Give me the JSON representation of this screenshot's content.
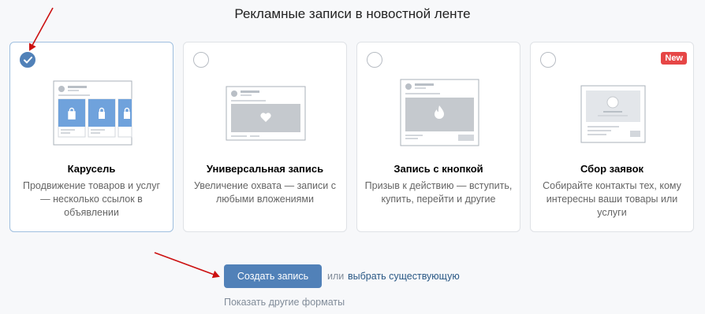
{
  "page": {
    "title": "Рекламные записи в новостной ленте"
  },
  "cards": [
    {
      "title": "Карусель",
      "description": "Продвижение товаров и услуг — несколько ссылок в объявлении",
      "selected": true,
      "illustration": "carousel-post-icon"
    },
    {
      "title": "Универсальная запись",
      "description": "Увеличение охвата — записи с любыми вложениями",
      "selected": false,
      "illustration": "universal-post-icon"
    },
    {
      "title": "Запись с кнопкой",
      "description": "Призыв к действию — вступить, купить, перейти и другие",
      "selected": false,
      "illustration": "button-post-icon"
    },
    {
      "title": "Сбор заявок",
      "description": "Собирайте контакты тех, кому интересны ваши товары или услуги",
      "selected": false,
      "badge": "New",
      "illustration": "lead-form-icon"
    }
  ],
  "actions": {
    "create_label": "Создать запись",
    "or_label": "или",
    "choose_existing_label": "выбрать существующую",
    "show_other_label": "Показать другие форматы"
  },
  "colors": {
    "accent": "#5181b8",
    "link": "#2a5885",
    "badge": "#e64646",
    "annotation_arrow": "#cc1111"
  }
}
